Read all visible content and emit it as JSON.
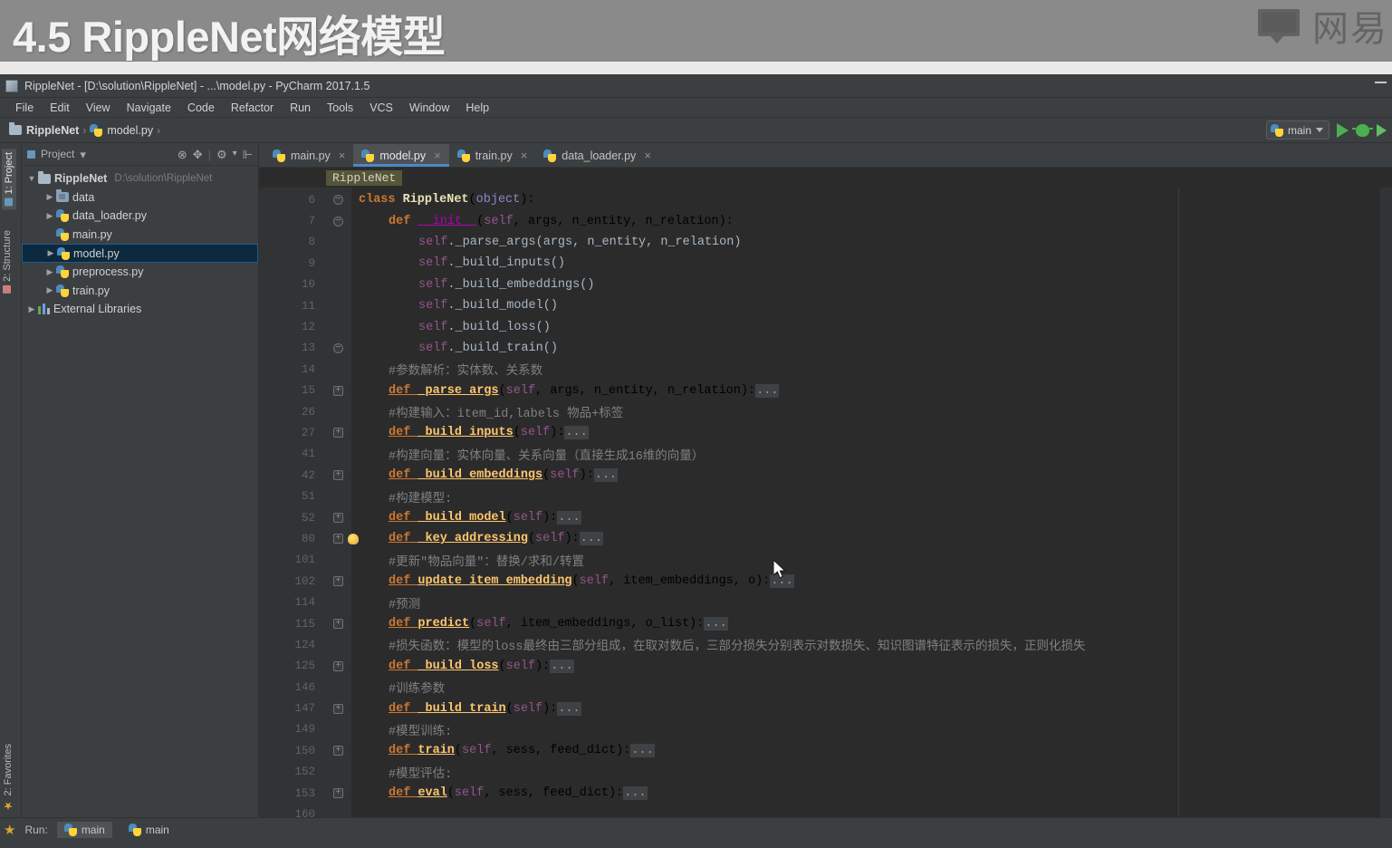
{
  "slide": {
    "title": "4.5 RippleNet网络模型",
    "watermark_text": "网易",
    "watermark_icon": "netease-book-icon"
  },
  "window": {
    "title": "RippleNet - [D:\\solution\\RippleNet] - ...\\model.py - PyCharm 2017.1.5",
    "app_icon": "pycharm-icon",
    "minimize_label": "—"
  },
  "menubar": {
    "items": [
      {
        "label": "File"
      },
      {
        "label": "Edit"
      },
      {
        "label": "View"
      },
      {
        "label": "Navigate"
      },
      {
        "label": "Code"
      },
      {
        "label": "Refactor"
      },
      {
        "label": "Run"
      },
      {
        "label": "Tools"
      },
      {
        "label": "VCS"
      },
      {
        "label": "Window"
      },
      {
        "label": "Help"
      }
    ]
  },
  "navbar": {
    "crumbs": [
      {
        "label": "RippleNet",
        "icon": "folder-icon"
      },
      {
        "label": "model.py",
        "icon": "python-file-icon"
      }
    ],
    "run_config": "main",
    "run_button": "run-icon",
    "debug_button": "debug-icon",
    "run_coverage_button": "run-with-coverage-icon"
  },
  "tool_strip": {
    "left_top": [
      {
        "label": "1: Project",
        "active": true
      },
      {
        "label": "2: Structure",
        "active": false
      }
    ],
    "left_bottom": [
      {
        "label": "2: Favorites",
        "active": false
      }
    ]
  },
  "project_panel": {
    "title": "Project",
    "dropdown_caret": "▾",
    "toolbar_icons": [
      "collapse-all-icon",
      "target-icon",
      "settings-icon",
      "hide-icon"
    ],
    "tree": [
      {
        "indent": 0,
        "twisty": "▼",
        "icon": "folder-icon",
        "label": "RippleNet",
        "bold": true,
        "path": "D:\\solution\\RippleNet",
        "selected": false
      },
      {
        "indent": 1,
        "twisty": "▶",
        "icon": "folder-blue-icon",
        "label": "data",
        "bold": false,
        "path": "",
        "selected": false
      },
      {
        "indent": 1,
        "twisty": "▶",
        "icon": "python-file-icon",
        "label": "data_loader.py",
        "bold": false,
        "path": "",
        "selected": false
      },
      {
        "indent": 1,
        "twisty": "",
        "icon": "python-file-icon",
        "label": "main.py",
        "bold": false,
        "path": "",
        "selected": false
      },
      {
        "indent": 1,
        "twisty": "▶",
        "icon": "python-file-icon",
        "label": "model.py",
        "bold": false,
        "path": "",
        "selected": true
      },
      {
        "indent": 1,
        "twisty": "▶",
        "icon": "python-file-icon",
        "label": "preprocess.py",
        "bold": false,
        "path": "",
        "selected": false
      },
      {
        "indent": 1,
        "twisty": "▶",
        "icon": "python-file-icon",
        "label": "train.py",
        "bold": false,
        "path": "",
        "selected": false
      },
      {
        "indent": 0,
        "twisty": "▶",
        "icon": "library-icon",
        "label": "External Libraries",
        "bold": false,
        "path": "",
        "selected": false
      }
    ]
  },
  "editor": {
    "tabs": [
      {
        "label": "main.py",
        "active": false
      },
      {
        "label": "model.py",
        "active": true
      },
      {
        "label": "train.py",
        "active": false
      },
      {
        "label": "data_loader.py",
        "active": false
      }
    ],
    "breadcrumb_chip": "RippleNet",
    "file_name": "model.py",
    "lines": [
      {
        "num": "6",
        "fold": "circ",
        "bulb": false,
        "indent": 0,
        "text": "class RippleNet(object):"
      },
      {
        "num": "7",
        "fold": "circ",
        "bulb": false,
        "indent": 1,
        "text": "def __init__(self, args, n_entity, n_relation):"
      },
      {
        "num": "8",
        "fold": "",
        "bulb": false,
        "indent": 2,
        "text": "self._parse_args(args, n_entity, n_relation)"
      },
      {
        "num": "9",
        "fold": "",
        "bulb": false,
        "indent": 2,
        "text": "self._build_inputs()"
      },
      {
        "num": "10",
        "fold": "",
        "bulb": false,
        "indent": 2,
        "text": "self._build_embeddings()"
      },
      {
        "num": "11",
        "fold": "",
        "bulb": false,
        "indent": 2,
        "text": "self._build_model()"
      },
      {
        "num": "12",
        "fold": "",
        "bulb": false,
        "indent": 2,
        "text": "self._build_loss()"
      },
      {
        "num": "13",
        "fold": "circ",
        "bulb": false,
        "indent": 2,
        "text": "self._build_train()"
      },
      {
        "num": "14",
        "fold": "",
        "bulb": false,
        "indent": 1,
        "text": "#参数解析：实体数、关系数"
      },
      {
        "num": "15",
        "fold": "box",
        "bulb": false,
        "indent": 1,
        "text": "def _parse_args(self, args, n_entity, n_relation):..."
      },
      {
        "num": "26",
        "fold": "",
        "bulb": false,
        "indent": 1,
        "text": "#构建输入：item_id,labels 物品+标签"
      },
      {
        "num": "27",
        "fold": "box",
        "bulb": false,
        "indent": 1,
        "text": "def _build_inputs(self):..."
      },
      {
        "num": "41",
        "fold": "",
        "bulb": false,
        "indent": 1,
        "text": "#构建向量：实体向量、关系向量（直接生成16维的向量）"
      },
      {
        "num": "42",
        "fold": "box",
        "bulb": false,
        "indent": 1,
        "text": "def _build_embeddings(self):..."
      },
      {
        "num": "51",
        "fold": "",
        "bulb": false,
        "indent": 1,
        "text": "#构建模型:"
      },
      {
        "num": "52",
        "fold": "box",
        "bulb": false,
        "indent": 1,
        "text": "def _build_model(self):..."
      },
      {
        "num": "80",
        "fold": "box",
        "bulb": true,
        "indent": 1,
        "text": "def _key_addressing(self):..."
      },
      {
        "num": "101",
        "fold": "",
        "bulb": false,
        "indent": 1,
        "text": "#更新\"物品向量\"：替换/求和/转置"
      },
      {
        "num": "102",
        "fold": "box",
        "bulb": false,
        "indent": 1,
        "text": "def update_item_embedding(self, item_embeddings, o):..."
      },
      {
        "num": "114",
        "fold": "",
        "bulb": false,
        "indent": 1,
        "text": "#预测"
      },
      {
        "num": "115",
        "fold": "box",
        "bulb": false,
        "indent": 1,
        "text": "def predict(self, item_embeddings, o_list):..."
      },
      {
        "num": "124",
        "fold": "",
        "bulb": false,
        "indent": 1,
        "text": "#损失函数：模型的loss最终由三部分组成，在取对数后，三部分损失分别表示对数损失、知识图谱特征表示的损失，正则化损失"
      },
      {
        "num": "125",
        "fold": "box",
        "bulb": false,
        "indent": 1,
        "text": "def _build_loss(self):..."
      },
      {
        "num": "146",
        "fold": "",
        "bulb": false,
        "indent": 1,
        "text": "#训练参数"
      },
      {
        "num": "147",
        "fold": "box",
        "bulb": false,
        "indent": 1,
        "text": "def _build_train(self):..."
      },
      {
        "num": "149",
        "fold": "",
        "bulb": false,
        "indent": 1,
        "text": "#模型训练:"
      },
      {
        "num": "150",
        "fold": "box",
        "bulb": false,
        "indent": 1,
        "text": "def train(self, sess, feed_dict):..."
      },
      {
        "num": "152",
        "fold": "",
        "bulb": false,
        "indent": 1,
        "text": "#模型评估:"
      },
      {
        "num": "153",
        "fold": "box",
        "bulb": false,
        "indent": 1,
        "text": "def eval(self, sess, feed_dict):..."
      },
      {
        "num": "160",
        "fold": "",
        "bulb": false,
        "indent": 1,
        "text": ""
      }
    ]
  },
  "statusbar": {
    "favorites_star": "star-icon",
    "run_label": "Run:",
    "items": [
      {
        "label": "main",
        "icon": "python-file-icon",
        "active": true
      },
      {
        "label": "main",
        "icon": "python-file-icon",
        "active": false
      }
    ]
  },
  "colors": {
    "accent_blue": "#4a88c7",
    "keyword_orange": "#cc7832",
    "function_yellow": "#ffc66d",
    "self_purple": "#94558d",
    "comment_gray": "#808080",
    "editor_bg": "#2b2b2b",
    "chrome_bg": "#3c3f41",
    "selection_blue": "#0d293e"
  }
}
